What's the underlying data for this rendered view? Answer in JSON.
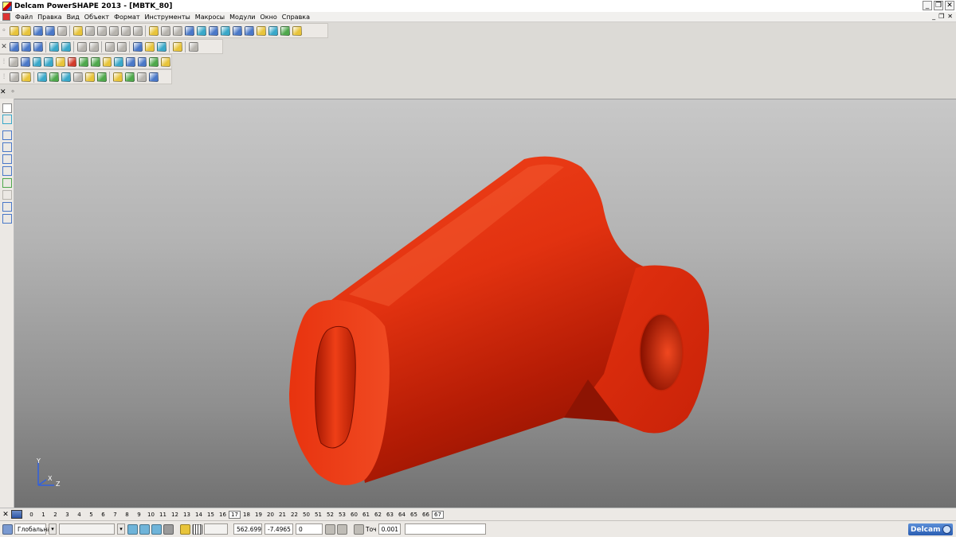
{
  "window": {
    "title": "Delcam PowerSHAPE 2013 - [MBTK_80]",
    "minimize": "_",
    "restore": "❐",
    "close": "✕"
  },
  "menu": {
    "items": [
      "Файл",
      "Правка",
      "Вид",
      "Объект",
      "Формат",
      "Инструменты",
      "Макросы",
      "Модули",
      "Окно",
      "Справка"
    ],
    "mdi_minimize": "_",
    "mdi_restore": "❐",
    "mdi_close": "✕"
  },
  "toolbars": {
    "close_label": "✕",
    "colors": {
      "blue": "#4a78c8",
      "yellow": "#e8c43a",
      "green": "#4ea84b",
      "red": "#d23b2a",
      "cyan": "#39a8c9",
      "gray": "#b7b4ae"
    }
  },
  "viewport": {
    "background_top": "#c8c8c8",
    "background_bottom": "#707070",
    "model_color": "#d62a0a",
    "axis": {
      "y": "Y",
      "x": "X",
      "z": "Z"
    }
  },
  "levels": {
    "close_label": "✕",
    "items": [
      "0",
      "1",
      "2",
      "3",
      "4",
      "5",
      "6",
      "7",
      "8",
      "9",
      "10",
      "11",
      "12",
      "13",
      "14",
      "15",
      "16",
      "17",
      "18",
      "19",
      "20",
      "21",
      "22",
      "50",
      "51",
      "52",
      "53",
      "60",
      "61",
      "62",
      "63",
      "64",
      "65",
      "66",
      "67"
    ],
    "active": [
      "17",
      "67"
    ]
  },
  "status": {
    "workplane": "Глобальна",
    "coord_x": "562.699",
    "coord_y": "-7.4965",
    "coord_z": "0",
    "tolerance_label": "Точ",
    "tolerance_value": "0.001",
    "logo_text": "Delcam"
  }
}
